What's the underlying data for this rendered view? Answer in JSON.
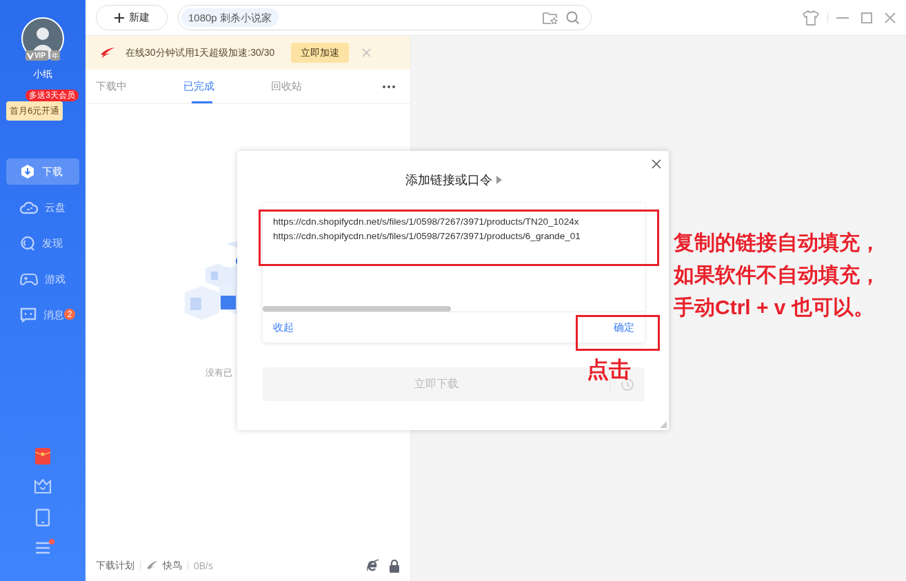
{
  "sidebar": {
    "user": {
      "name": "小纸",
      "vip_badge": "VIP",
      "year_badge": "年",
      "promo_tag": "多送3天会员",
      "promo_button": "首月6元开通"
    },
    "nav": [
      {
        "label": "下载",
        "kind": "download",
        "selected": true
      },
      {
        "label": "云盘",
        "kind": "cloud",
        "selected": false
      },
      {
        "label": "发现",
        "kind": "discover",
        "selected": false
      },
      {
        "label": "游戏",
        "kind": "games",
        "selected": false
      },
      {
        "label": "消息",
        "kind": "messages",
        "selected": false,
        "badge": "2"
      }
    ],
    "tools": [
      {
        "kind": "gift",
        "notify": false
      },
      {
        "kind": "vip",
        "notify": false
      },
      {
        "kind": "device",
        "notify": false
      },
      {
        "kind": "menu",
        "notify": true
      }
    ]
  },
  "toolbar": {
    "new_button": "新建",
    "search_tag": "1080p 刺杀小说家"
  },
  "banner": {
    "text": "在线30分钟试用1天超级加速:30/30",
    "button": "立即加速"
  },
  "tabs": [
    {
      "label": "下载中",
      "selected": false
    },
    {
      "label": "已完成",
      "selected": true
    },
    {
      "label": "回收站",
      "selected": false
    }
  ],
  "empty_text": "没有已",
  "status_bar": {
    "plan": "下载计划",
    "accelerator": "快鸟",
    "speed": "0B/s"
  },
  "dialog": {
    "title": "添加链接或口令",
    "links": [
      "https://cdn.shopifycdn.net/s/files/1/0598/7267/3971/products/TN20_1024x",
      "https://cdn.shopifycdn.net/s/files/1/0598/7267/3971/products/6_grande_01"
    ],
    "collapse": "收起",
    "confirm": "确定",
    "download_button": "立即下载",
    "download_disabled": true
  },
  "annotations": {
    "click_label": "点击",
    "caption": [
      "复制的链接自动填充，",
      "如果软件不自动填充，",
      "手动Ctrl + v 也可以。"
    ]
  }
}
